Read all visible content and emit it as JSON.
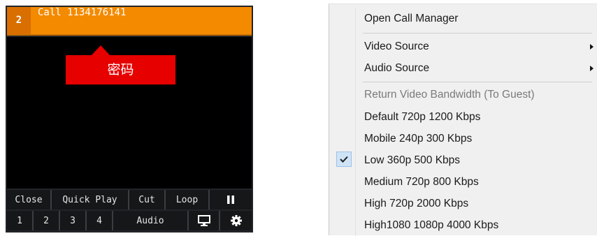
{
  "call_panel": {
    "call_number": "2",
    "call_title": "Call 1134176141",
    "callout_label": "密码",
    "controls_row1": [
      "Close",
      "Quick Play",
      "Cut",
      "Loop"
    ],
    "pause_icon": "pause-icon",
    "controls_row2": [
      "1",
      "2",
      "3",
      "4",
      "Audio"
    ],
    "monitor_icon": "monitor-icon",
    "settings_icon": "gear-icon",
    "colors": {
      "title_bar": "#f48a00",
      "callout": "#e60000"
    }
  },
  "context_menu": {
    "open_call_manager": "Open Call Manager",
    "video_source": "Video Source",
    "audio_source": "Audio Source",
    "bandwidth_header": "Return Video Bandwidth (To Guest)",
    "bandwidth_options": [
      "Default 720p 1200 Kbps",
      "Mobile 240p 300 Kbps",
      "Low 360p 500 Kbps",
      "Medium 720p 800 Kbps",
      "High 720p 2000 Kbps",
      "High1080 1080p 4000 Kbps"
    ],
    "selected_option": "Low 360p 500 Kbps"
  }
}
